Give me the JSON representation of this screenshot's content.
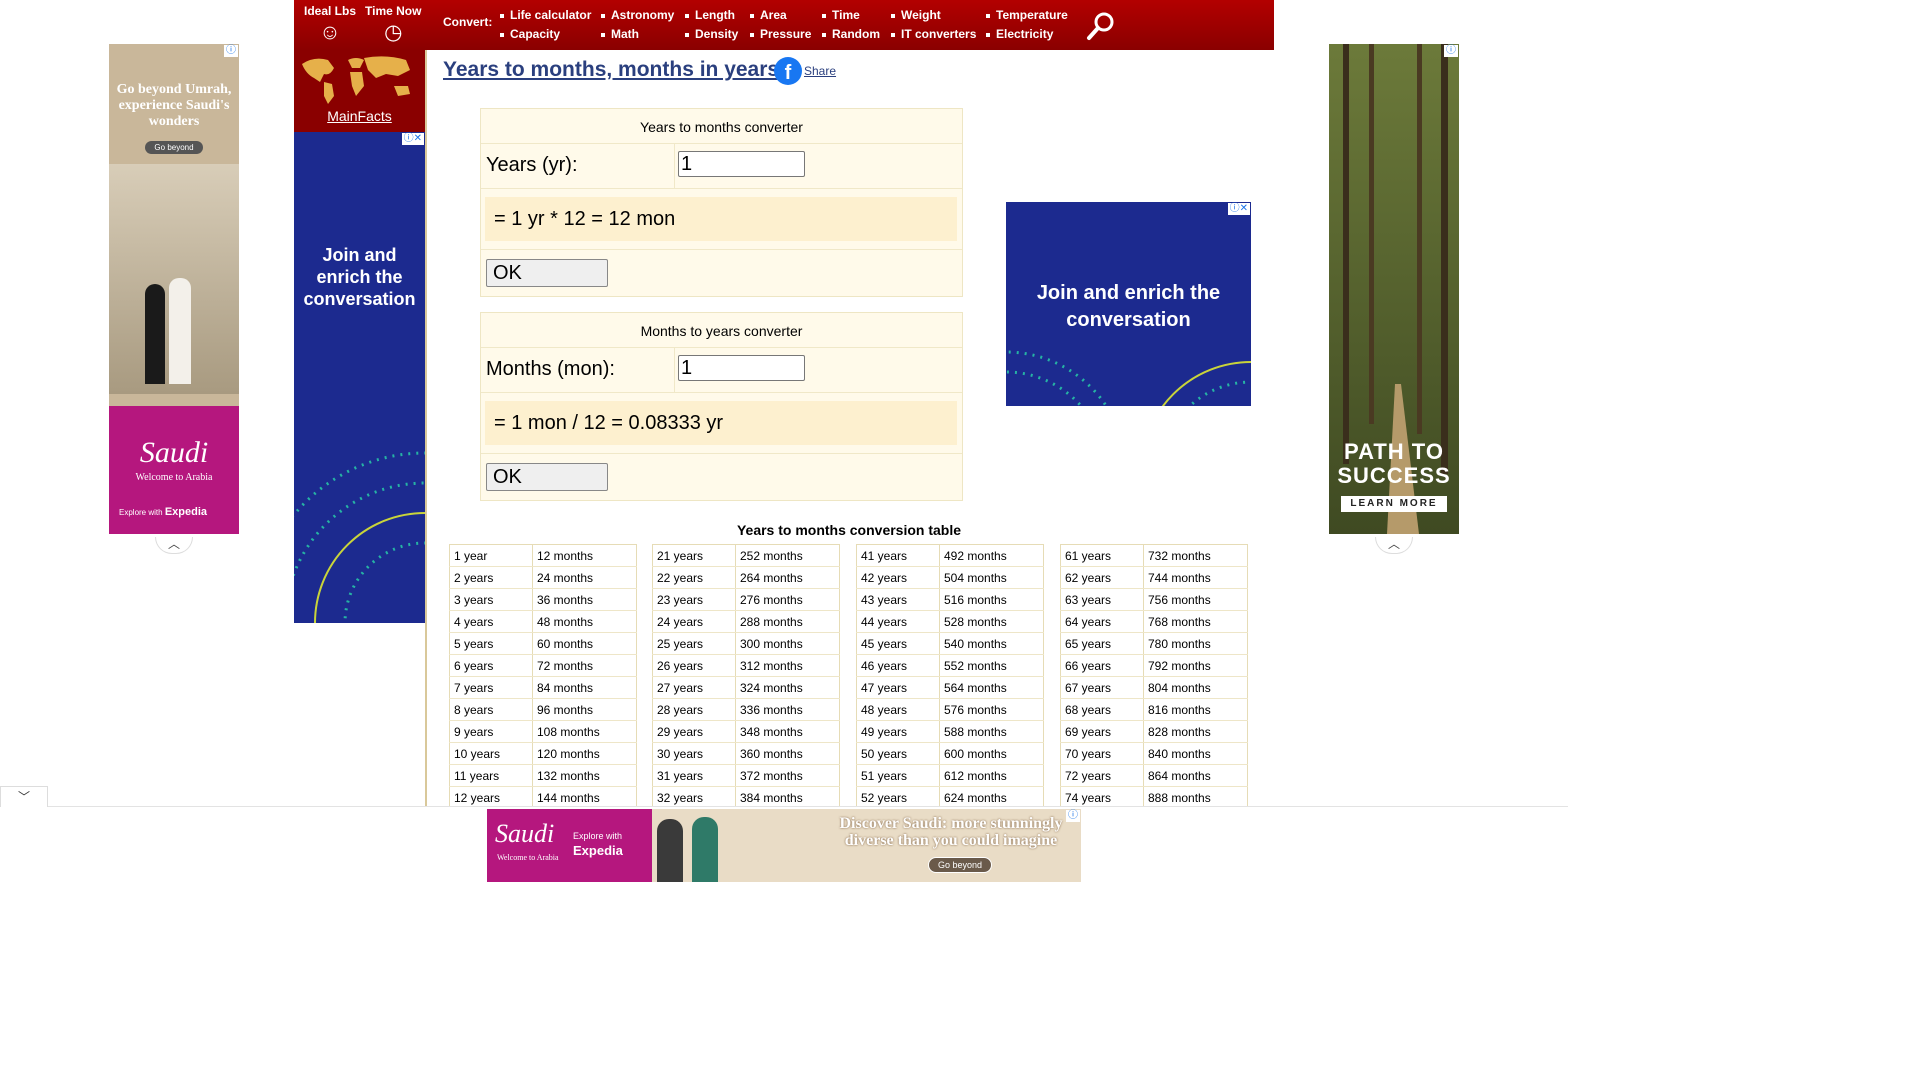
{
  "nav": {
    "quick": [
      {
        "label": "Ideal Lbs",
        "icon": "smiley-icon",
        "glyph": "☺"
      },
      {
        "label": "Time Now",
        "icon": "clock-icon",
        "glyph": "◷"
      }
    ],
    "convert_label": "Convert",
    "links_row1": [
      "Life calculator",
      "Astronomy",
      "Length",
      "Area",
      "Time",
      "Weight",
      "Temperature"
    ],
    "links_row2": [
      "Capacity",
      "Math",
      "Density",
      "Pressure",
      "Random",
      "IT converters",
      "Electricity"
    ],
    "search_icon": "search-icon"
  },
  "sidebar": {
    "link": "MainFacts",
    "map_icon": "world-map-icon"
  },
  "page": {
    "title": "Years to months, months in years",
    "share_label": "Share",
    "share_icon": "facebook-icon"
  },
  "converter1": {
    "title": "Years to months converter",
    "input_label": "Years (yr):",
    "input_value": "1",
    "result": "= 1 yr * 12 = 12 mon",
    "button": "OK"
  },
  "converter2": {
    "title": "Months to years converter",
    "input_label": "Months (mon):",
    "input_value": "1",
    "result": "= 1 mon / 12 = 0.08333 yr",
    "button": "OK"
  },
  "table": {
    "title": "Years to months conversion table",
    "columns": [
      [
        [
          "1 year",
          "12 months"
        ],
        [
          "2 years",
          "24 months"
        ],
        [
          "3 years",
          "36 months"
        ],
        [
          "4 years",
          "48 months"
        ],
        [
          "5 years",
          "60 months"
        ],
        [
          "6 years",
          "72 months"
        ],
        [
          "7 years",
          "84 months"
        ],
        [
          "8 years",
          "96 months"
        ],
        [
          "9 years",
          "108 months"
        ],
        [
          "10 years",
          "120 months"
        ],
        [
          "11 years",
          "132 months"
        ],
        [
          "12 years",
          "144 months"
        ]
      ],
      [
        [
          "21 years",
          "252 months"
        ],
        [
          "22 years",
          "264 months"
        ],
        [
          "23 years",
          "276 months"
        ],
        [
          "24 years",
          "288 months"
        ],
        [
          "25 years",
          "300 months"
        ],
        [
          "26 years",
          "312 months"
        ],
        [
          "27 years",
          "324 months"
        ],
        [
          "28 years",
          "336 months"
        ],
        [
          "29 years",
          "348 months"
        ],
        [
          "30 years",
          "360 months"
        ],
        [
          "31 years",
          "372 months"
        ],
        [
          "32 years",
          "384 months"
        ]
      ],
      [
        [
          "41 years",
          "492 months"
        ],
        [
          "42 years",
          "504 months"
        ],
        [
          "43 years",
          "516 months"
        ],
        [
          "44 years",
          "528 months"
        ],
        [
          "45 years",
          "540 months"
        ],
        [
          "46 years",
          "552 months"
        ],
        [
          "47 years",
          "564 months"
        ],
        [
          "48 years",
          "576 months"
        ],
        [
          "49 years",
          "588 months"
        ],
        [
          "50 years",
          "600 months"
        ],
        [
          "51 years",
          "612 months"
        ],
        [
          "52 years",
          "624 months"
        ]
      ],
      [
        [
          "61 years",
          "732 months"
        ],
        [
          "62 years",
          "744 months"
        ],
        [
          "63 years",
          "756 months"
        ],
        [
          "64 years",
          "768 months"
        ],
        [
          "65 years",
          "780 months"
        ],
        [
          "66 years",
          "792 months"
        ],
        [
          "67 years",
          "804 months"
        ],
        [
          "68 years",
          "816 months"
        ],
        [
          "69 years",
          "828 months"
        ],
        [
          "70 years",
          "840 months"
        ],
        [
          "72 years",
          "864 months"
        ],
        [
          "74 years",
          "888 months"
        ]
      ]
    ]
  },
  "ads": {
    "left": {
      "headline": "Go beyond Umrah, experience Saudi's wonders",
      "cta": "Go beyond",
      "brand": "Saudi",
      "brand_sub": "Welcome to Arabia",
      "partner": "Explore with",
      "partner_brand": "Expedia",
      "color": "#b5177e"
    },
    "sidebar": {
      "headline": "Join and enrich the conversation",
      "color": "#1c2a8f"
    },
    "mid": {
      "headline": "Join and enrich the conversation",
      "color": "#1c2a8f"
    },
    "right": {
      "headline": "PATH TO SUCCESS",
      "cta": "LEARN MORE",
      "color": "#4a5a2c"
    },
    "bottom": {
      "brand": "Saudi",
      "brand_sub": "Welcome to Arabia",
      "partner": "Explore with",
      "partner_brand": "Expedia",
      "headline": "Discover Saudi: more stunningly diverse than you could imagine",
      "cta": "Go beyond",
      "color": "#b5177e"
    }
  },
  "ad_controls": {
    "info_icon": "ⓘ",
    "close_icon": "✕",
    "up_glyph": "︿",
    "down_glyph": "﹀"
  }
}
